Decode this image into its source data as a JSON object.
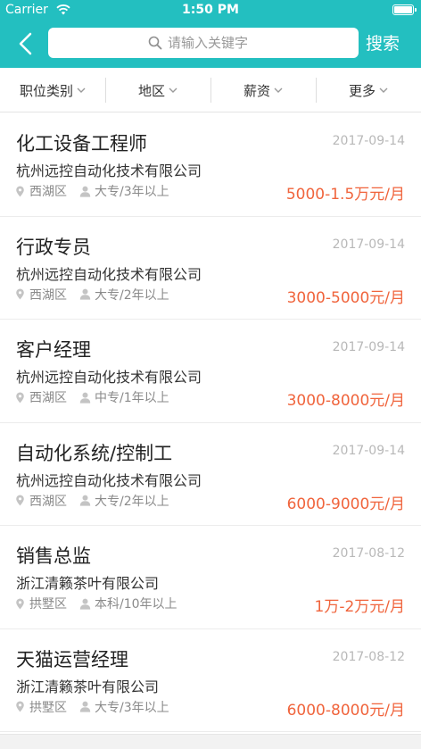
{
  "status_bar": {
    "carrier": "Carrier",
    "time": "1:50 PM"
  },
  "header": {
    "search_placeholder": "请输入关键字",
    "search_button": "搜索"
  },
  "filters": [
    {
      "label": "职位类别"
    },
    {
      "label": "地区"
    },
    {
      "label": "薪资"
    },
    {
      "label": "更多"
    }
  ],
  "jobs": [
    {
      "title": "化工设备工程师",
      "date": "2017-09-14",
      "company": "杭州远控自动化技术有限公司",
      "location": "西湖区",
      "requirement": "大专/3年以上",
      "salary": "5000-1.5万元/月"
    },
    {
      "title": "行政专员",
      "date": "2017-09-14",
      "company": "杭州远控自动化技术有限公司",
      "location": "西湖区",
      "requirement": "大专/2年以上",
      "salary": "3000-5000元/月"
    },
    {
      "title": "客户经理",
      "date": "2017-09-14",
      "company": "杭州远控自动化技术有限公司",
      "location": "西湖区",
      "requirement": "中专/1年以上",
      "salary": "3000-8000元/月"
    },
    {
      "title": "自动化系统/控制工",
      "date": "2017-09-14",
      "company": "杭州远控自动化技术有限公司",
      "location": "西湖区",
      "requirement": "大专/2年以上",
      "salary": "6000-9000元/月"
    },
    {
      "title": "销售总监",
      "date": "2017-08-12",
      "company": "浙江清籁茶叶有限公司",
      "location": "拱墅区",
      "requirement": "本科/10年以上",
      "salary": "1万-2万元/月"
    },
    {
      "title": "天猫运营经理",
      "date": "2017-08-12",
      "company": "浙江清籁茶叶有限公司",
      "location": "拱墅区",
      "requirement": "大专/3年以上",
      "salary": "6000-8000元/月"
    }
  ],
  "colors": {
    "accent": "#23bfc0",
    "salary": "#f0643c"
  },
  "icons": {
    "back": "chevron-left-icon",
    "search": "search-icon",
    "location": "location-pin-icon",
    "requirement": "person-icon",
    "dropdown": "chevron-down-icon"
  }
}
